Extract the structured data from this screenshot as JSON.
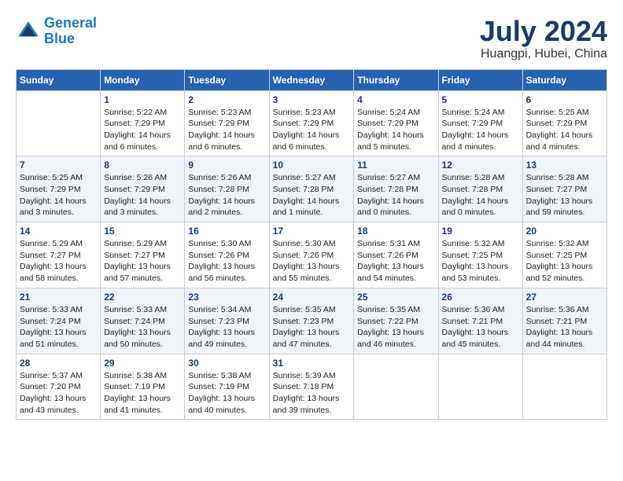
{
  "header": {
    "logo_line1": "General",
    "logo_line2": "Blue",
    "month": "July 2024",
    "location": "Huangpi, Hubei, China"
  },
  "weekdays": [
    "Sunday",
    "Monday",
    "Tuesday",
    "Wednesday",
    "Thursday",
    "Friday",
    "Saturday"
  ],
  "weeks": [
    [
      {
        "day": "",
        "info": ""
      },
      {
        "day": "1",
        "info": "Sunrise: 5:22 AM\nSunset: 7:29 PM\nDaylight: 14 hours\nand 6 minutes."
      },
      {
        "day": "2",
        "info": "Sunrise: 5:23 AM\nSunset: 7:29 PM\nDaylight: 14 hours\nand 6 minutes."
      },
      {
        "day": "3",
        "info": "Sunrise: 5:23 AM\nSunset: 7:29 PM\nDaylight: 14 hours\nand 6 minutes."
      },
      {
        "day": "4",
        "info": "Sunrise: 5:24 AM\nSunset: 7:29 PM\nDaylight: 14 hours\nand 5 minutes."
      },
      {
        "day": "5",
        "info": "Sunrise: 5:24 AM\nSunset: 7:29 PM\nDaylight: 14 hours\nand 4 minutes."
      },
      {
        "day": "6",
        "info": "Sunrise: 5:25 AM\nSunset: 7:29 PM\nDaylight: 14 hours\nand 4 minutes."
      }
    ],
    [
      {
        "day": "7",
        "info": "Sunrise: 5:25 AM\nSunset: 7:29 PM\nDaylight: 14 hours\nand 3 minutes."
      },
      {
        "day": "8",
        "info": "Sunrise: 5:26 AM\nSunset: 7:29 PM\nDaylight: 14 hours\nand 3 minutes."
      },
      {
        "day": "9",
        "info": "Sunrise: 5:26 AM\nSunset: 7:28 PM\nDaylight: 14 hours\nand 2 minutes."
      },
      {
        "day": "10",
        "info": "Sunrise: 5:27 AM\nSunset: 7:28 PM\nDaylight: 14 hours\nand 1 minute."
      },
      {
        "day": "11",
        "info": "Sunrise: 5:27 AM\nSunset: 7:28 PM\nDaylight: 14 hours\nand 0 minutes."
      },
      {
        "day": "12",
        "info": "Sunrise: 5:28 AM\nSunset: 7:28 PM\nDaylight: 14 hours\nand 0 minutes."
      },
      {
        "day": "13",
        "info": "Sunrise: 5:28 AM\nSunset: 7:27 PM\nDaylight: 13 hours\nand 59 minutes."
      }
    ],
    [
      {
        "day": "14",
        "info": "Sunrise: 5:29 AM\nSunset: 7:27 PM\nDaylight: 13 hours\nand 58 minutes."
      },
      {
        "day": "15",
        "info": "Sunrise: 5:29 AM\nSunset: 7:27 PM\nDaylight: 13 hours\nand 57 minutes."
      },
      {
        "day": "16",
        "info": "Sunrise: 5:30 AM\nSunset: 7:26 PM\nDaylight: 13 hours\nand 56 minutes."
      },
      {
        "day": "17",
        "info": "Sunrise: 5:30 AM\nSunset: 7:26 PM\nDaylight: 13 hours\nand 55 minutes."
      },
      {
        "day": "18",
        "info": "Sunrise: 5:31 AM\nSunset: 7:26 PM\nDaylight: 13 hours\nand 54 minutes."
      },
      {
        "day": "19",
        "info": "Sunrise: 5:32 AM\nSunset: 7:25 PM\nDaylight: 13 hours\nand 53 minutes."
      },
      {
        "day": "20",
        "info": "Sunrise: 5:32 AM\nSunset: 7:25 PM\nDaylight: 13 hours\nand 52 minutes."
      }
    ],
    [
      {
        "day": "21",
        "info": "Sunrise: 5:33 AM\nSunset: 7:24 PM\nDaylight: 13 hours\nand 51 minutes."
      },
      {
        "day": "22",
        "info": "Sunrise: 5:33 AM\nSunset: 7:24 PM\nDaylight: 13 hours\nand 50 minutes."
      },
      {
        "day": "23",
        "info": "Sunrise: 5:34 AM\nSunset: 7:23 PM\nDaylight: 13 hours\nand 49 minutes."
      },
      {
        "day": "24",
        "info": "Sunrise: 5:35 AM\nSunset: 7:23 PM\nDaylight: 13 hours\nand 47 minutes."
      },
      {
        "day": "25",
        "info": "Sunrise: 5:35 AM\nSunset: 7:22 PM\nDaylight: 13 hours\nand 46 minutes."
      },
      {
        "day": "26",
        "info": "Sunrise: 5:36 AM\nSunset: 7:21 PM\nDaylight: 13 hours\nand 45 minutes."
      },
      {
        "day": "27",
        "info": "Sunrise: 5:36 AM\nSunset: 7:21 PM\nDaylight: 13 hours\nand 44 minutes."
      }
    ],
    [
      {
        "day": "28",
        "info": "Sunrise: 5:37 AM\nSunset: 7:20 PM\nDaylight: 13 hours\nand 43 minutes."
      },
      {
        "day": "29",
        "info": "Sunrise: 5:38 AM\nSunset: 7:19 PM\nDaylight: 13 hours\nand 41 minutes."
      },
      {
        "day": "30",
        "info": "Sunrise: 5:38 AM\nSunset: 7:19 PM\nDaylight: 13 hours\nand 40 minutes."
      },
      {
        "day": "31",
        "info": "Sunrise: 5:39 AM\nSunset: 7:18 PM\nDaylight: 13 hours\nand 39 minutes."
      },
      {
        "day": "",
        "info": ""
      },
      {
        "day": "",
        "info": ""
      },
      {
        "day": "",
        "info": ""
      }
    ]
  ]
}
